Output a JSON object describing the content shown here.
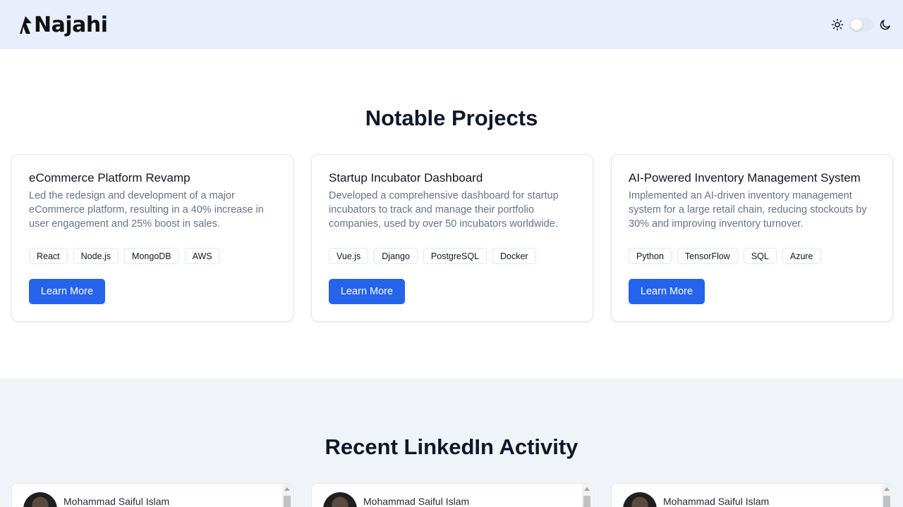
{
  "header": {
    "logo_text": "Najahi",
    "sun_icon": "sun-icon",
    "moon_icon": "moon-icon",
    "theme_toggle_state": "light"
  },
  "projects": {
    "title": "Notable Projects",
    "button_label": "Learn More",
    "items": [
      {
        "title": "eCommerce Platform Revamp",
        "description": "Led the redesign and development of a major eCommerce platform, resulting in a 40% increase in user engagement and 25% boost in sales.",
        "tags": [
          "React",
          "Node.js",
          "MongoDB",
          "AWS"
        ]
      },
      {
        "title": "Startup Incubator Dashboard",
        "description": "Developed a comprehensive dashboard for startup incubators to track and manage their portfolio companies, used by over 50 incubators worldwide.",
        "tags": [
          "Vue.js",
          "Django",
          "PostgreSQL",
          "Docker"
        ]
      },
      {
        "title": "AI-Powered Inventory Management System",
        "description": "Implemented an AI-driven inventory management system for a large retail chain, reducing stockouts by 30% and improving inventory turnover.",
        "tags": [
          "Python",
          "TensorFlow",
          "SQL",
          "Azure"
        ]
      }
    ]
  },
  "linkedin": {
    "title": "Recent LinkedIn Activity",
    "posts": [
      {
        "author": "Mohammad Saiful Islam"
      },
      {
        "author": "Mohammad Saiful Islam"
      },
      {
        "author": "Mohammad Saiful Islam"
      }
    ]
  },
  "colors": {
    "accent": "#2563eb",
    "header_bg": "#e8eefc",
    "section_alt_bg": "#f0f4f9"
  }
}
